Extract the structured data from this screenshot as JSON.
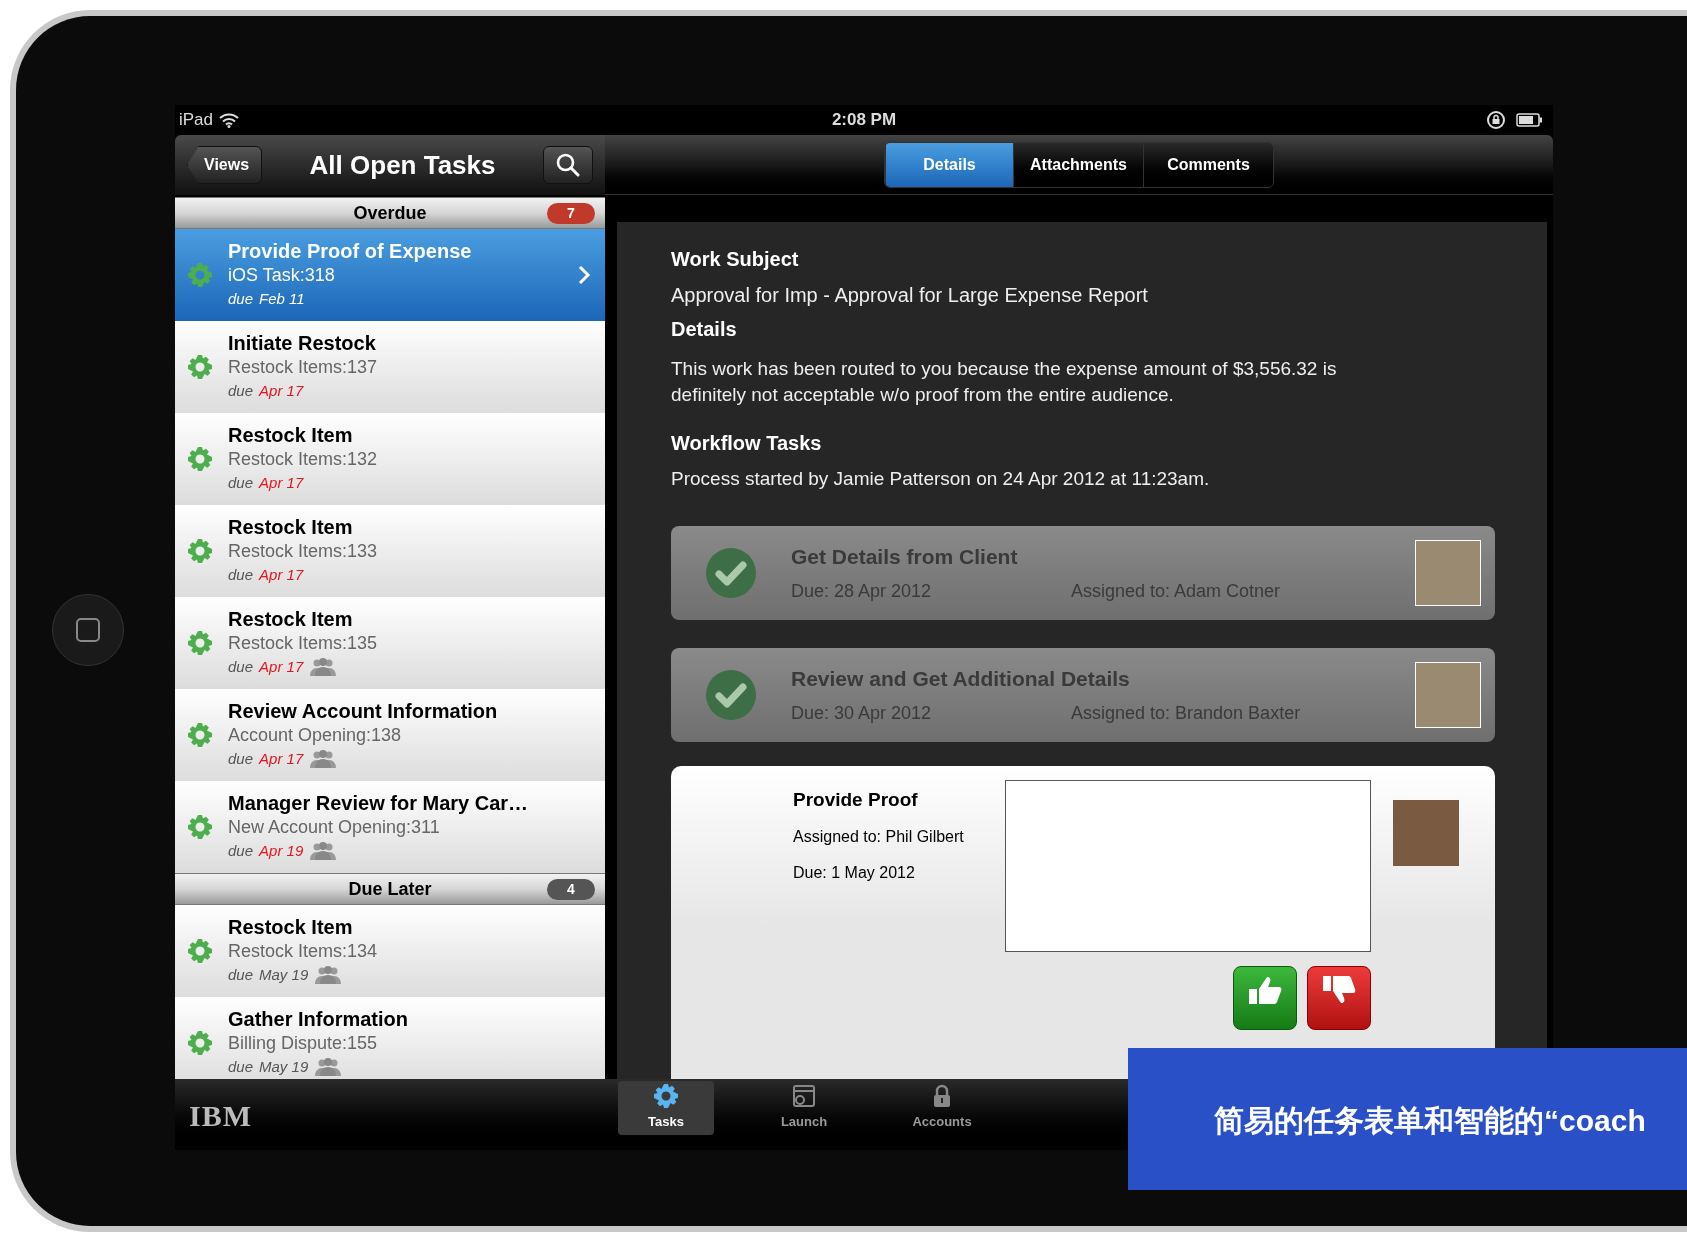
{
  "status_bar": {
    "carrier": "iPad",
    "time": "2:08 PM"
  },
  "list_header": {
    "back_button": "Views",
    "title": "All Open Tasks"
  },
  "sections": [
    {
      "title": "Overdue",
      "count": "7",
      "color": "#c0392b",
      "tasks": [
        {
          "title": "Provide Proof of Expense",
          "subtitle": "iOS Task:318",
          "due_label": "due",
          "due_date": "Feb 11",
          "late": false,
          "team": false,
          "selected": true
        },
        {
          "title": "Initiate Restock",
          "subtitle": "Restock Items:137",
          "due_label": "due",
          "due_date": "Apr 17",
          "late": true,
          "team": false,
          "selected": false
        },
        {
          "title": "Restock Item",
          "subtitle": "Restock Items:132",
          "due_label": "due",
          "due_date": "Apr 17",
          "late": true,
          "team": false,
          "selected": false
        },
        {
          "title": "Restock Item",
          "subtitle": "Restock Items:133",
          "due_label": "due",
          "due_date": "Apr 17",
          "late": true,
          "team": false,
          "selected": false
        },
        {
          "title": "Restock Item",
          "subtitle": "Restock Items:135",
          "due_label": "due",
          "due_date": "Apr 17",
          "late": true,
          "team": true,
          "selected": false
        },
        {
          "title": "Review Account Information",
          "subtitle": "Account Opening:138",
          "due_label": "due",
          "due_date": "Apr 17",
          "late": true,
          "team": true,
          "selected": false
        },
        {
          "title": "Manager Review for Mary Car…",
          "subtitle": "New Account Opening:311",
          "due_label": "due",
          "due_date": "Apr 19",
          "late": true,
          "team": true,
          "selected": false
        }
      ]
    },
    {
      "title": "Due Later",
      "count": "4",
      "color": "#555555",
      "tasks": [
        {
          "title": "Restock Item",
          "subtitle": "Restock Items:134",
          "due_label": "due",
          "due_date": "May 19",
          "late": false,
          "team": true,
          "selected": false
        },
        {
          "title": "Gather Information",
          "subtitle": "Billing Dispute:155",
          "due_label": "due",
          "due_date": "May 19",
          "late": false,
          "team": true,
          "selected": false
        }
      ]
    }
  ],
  "detail_tabs": [
    {
      "label": "Details",
      "selected": true
    },
    {
      "label": "Attachments",
      "selected": false
    },
    {
      "label": "Comments",
      "selected": false
    }
  ],
  "details": {
    "work_subject_label": "Work Subject",
    "work_subject": "Approval for Imp - Approval for Large Expense Report",
    "details_label": "Details",
    "details_text": "This work has been routed to you because the expense amount of $3,556.32 is definitely not acceptable w/o proof from the entire audience.",
    "workflow_label": "Workflow Tasks",
    "process_text": "Process started by Jamie Patterson on 24 Apr 2012 at 11:23am."
  },
  "workflow_tasks": [
    {
      "kind": "completed",
      "title": "Get Details from Client",
      "due_label": "Due:",
      "due": "28 Apr 2012",
      "assigned_label": "Assigned to:",
      "assignee": "Adam Cotner"
    },
    {
      "kind": "completed",
      "title": "Review and Get Additional Details",
      "due_label": "Due:",
      "due": "30 Apr 2012",
      "assigned_label": "Assigned to:",
      "assignee": "Brandon Baxter"
    },
    {
      "kind": "active",
      "title": "Provide Proof",
      "due_label": "Due:",
      "due": "1 May 2012",
      "assigned_label": "Assigned to:",
      "assignee": "Phil Gilbert"
    }
  ],
  "brand": "IBM",
  "tab_bar": [
    {
      "label": "Tasks",
      "selected": true
    },
    {
      "label": "Launch",
      "selected": false
    },
    {
      "label": "Accounts",
      "selected": false
    }
  ],
  "caption": "简易的任务表单和智能的“coach"
}
